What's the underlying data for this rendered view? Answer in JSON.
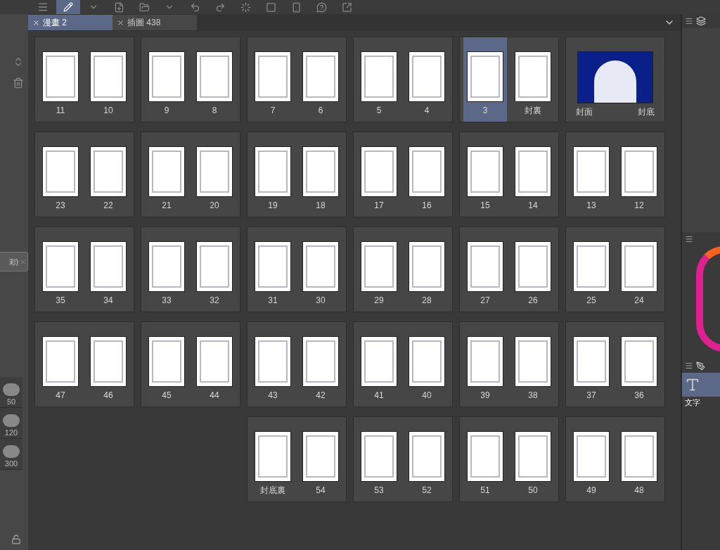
{
  "tabs": [
    {
      "label": "漫畫 2",
      "selected": true
    },
    {
      "label": "插圖 438",
      "selected": false
    }
  ],
  "left_panel": {
    "tag": "彩)",
    "brush_sizes": [
      "50",
      "120",
      "300"
    ]
  },
  "rows": [
    {
      "spreads": [
        {
          "kind": "pair",
          "pages": [
            {
              "label": "11",
              "selected": false
            },
            {
              "label": "10",
              "selected": false
            }
          ]
        },
        {
          "kind": "pair",
          "pages": [
            {
              "label": "9",
              "selected": false
            },
            {
              "label": "8",
              "selected": false
            }
          ]
        },
        {
          "kind": "pair",
          "pages": [
            {
              "label": "7",
              "selected": false
            },
            {
              "label": "6",
              "selected": false
            }
          ]
        },
        {
          "kind": "pair",
          "pages": [
            {
              "label": "5",
              "selected": false
            },
            {
              "label": "4",
              "selected": false
            }
          ]
        },
        {
          "kind": "pair",
          "pages": [
            {
              "label": "3",
              "selected": true
            },
            {
              "label": "封裏",
              "selected": false
            }
          ]
        },
        {
          "kind": "cover",
          "pages": [
            {
              "label": "封面",
              "selected": false
            },
            {
              "label": "封底",
              "selected": false
            }
          ]
        }
      ]
    },
    {
      "spreads": [
        {
          "kind": "pair",
          "pages": [
            {
              "label": "23",
              "selected": false
            },
            {
              "label": "22",
              "selected": false
            }
          ]
        },
        {
          "kind": "pair",
          "pages": [
            {
              "label": "21",
              "selected": false
            },
            {
              "label": "20",
              "selected": false
            }
          ]
        },
        {
          "kind": "pair",
          "pages": [
            {
              "label": "19",
              "selected": false
            },
            {
              "label": "18",
              "selected": false
            }
          ]
        },
        {
          "kind": "pair",
          "pages": [
            {
              "label": "17",
              "selected": false
            },
            {
              "label": "16",
              "selected": false
            }
          ]
        },
        {
          "kind": "pair",
          "pages": [
            {
              "label": "15",
              "selected": false
            },
            {
              "label": "14",
              "selected": false
            }
          ]
        },
        {
          "kind": "pair",
          "pages": [
            {
              "label": "13",
              "selected": false
            },
            {
              "label": "12",
              "selected": false
            }
          ]
        }
      ]
    },
    {
      "spreads": [
        {
          "kind": "pair",
          "pages": [
            {
              "label": "35",
              "selected": false
            },
            {
              "label": "34",
              "selected": false
            }
          ]
        },
        {
          "kind": "pair",
          "pages": [
            {
              "label": "33",
              "selected": false
            },
            {
              "label": "32",
              "selected": false
            }
          ]
        },
        {
          "kind": "pair",
          "pages": [
            {
              "label": "31",
              "selected": false
            },
            {
              "label": "30",
              "selected": false
            }
          ]
        },
        {
          "kind": "pair",
          "pages": [
            {
              "label": "29",
              "selected": false
            },
            {
              "label": "28",
              "selected": false
            }
          ]
        },
        {
          "kind": "pair",
          "pages": [
            {
              "label": "27",
              "selected": false
            },
            {
              "label": "26",
              "selected": false
            }
          ]
        },
        {
          "kind": "pair",
          "pages": [
            {
              "label": "25",
              "selected": false
            },
            {
              "label": "24",
              "selected": false
            }
          ]
        }
      ]
    },
    {
      "spreads": [
        {
          "kind": "pair",
          "pages": [
            {
              "label": "47",
              "selected": false
            },
            {
              "label": "46",
              "selected": false
            }
          ]
        },
        {
          "kind": "pair",
          "pages": [
            {
              "label": "45",
              "selected": false
            },
            {
              "label": "44",
              "selected": false
            }
          ]
        },
        {
          "kind": "pair",
          "pages": [
            {
              "label": "43",
              "selected": false
            },
            {
              "label": "42",
              "selected": false
            }
          ]
        },
        {
          "kind": "pair",
          "pages": [
            {
              "label": "41",
              "selected": false
            },
            {
              "label": "40",
              "selected": false
            }
          ]
        },
        {
          "kind": "pair",
          "pages": [
            {
              "label": "39",
              "selected": false
            },
            {
              "label": "38",
              "selected": false
            }
          ]
        },
        {
          "kind": "pair",
          "pages": [
            {
              "label": "37",
              "selected": false
            },
            {
              "label": "36",
              "selected": false
            }
          ]
        }
      ]
    },
    {
      "spreads": [
        {
          "kind": "pair",
          "pages": [
            {
              "label": "封底裏",
              "selected": false
            },
            {
              "label": "54",
              "selected": false
            }
          ]
        },
        {
          "kind": "pair",
          "pages": [
            {
              "label": "53",
              "selected": false
            },
            {
              "label": "52",
              "selected": false
            }
          ]
        },
        {
          "kind": "pair",
          "pages": [
            {
              "label": "51",
              "selected": false
            },
            {
              "label": "50",
              "selected": false
            }
          ]
        },
        {
          "kind": "pair",
          "pages": [
            {
              "label": "49",
              "selected": false
            },
            {
              "label": "48",
              "selected": false
            }
          ]
        }
      ]
    }
  ],
  "right_panel": {
    "text_tool": "文字"
  }
}
